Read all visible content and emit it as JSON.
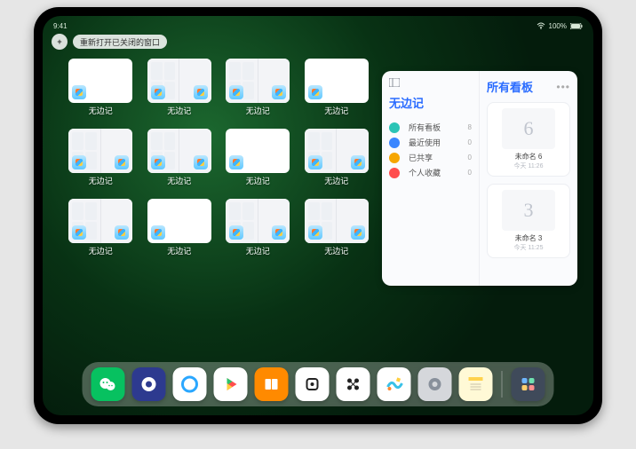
{
  "status": {
    "time": "9:41",
    "battery": "100%"
  },
  "topbar": {
    "add": "+",
    "reopen_label": "重新打开已关闭的窗口"
  },
  "appName": "无边记",
  "windows": [
    {
      "label": "无边记",
      "type": "blank"
    },
    {
      "label": "无边记",
      "type": "split"
    },
    {
      "label": "无边记",
      "type": "split"
    },
    {
      "label": "无边记",
      "type": "blank"
    },
    {
      "label": "无边记",
      "type": "split"
    },
    {
      "label": "无边记",
      "type": "split"
    },
    {
      "label": "无边记",
      "type": "blank"
    },
    {
      "label": "无边记",
      "type": "split"
    },
    {
      "label": "无边记",
      "type": "split"
    },
    {
      "label": "无边记",
      "type": "blank"
    },
    {
      "label": "无边记",
      "type": "split"
    },
    {
      "label": "无边记",
      "type": "split"
    }
  ],
  "panel": {
    "title": "无边记",
    "items": [
      {
        "icon": "circle",
        "color": "#2bc4b6",
        "label": "所有看板",
        "count": 8
      },
      {
        "icon": "clock",
        "color": "#3a86ff",
        "label": "最近使用",
        "count": 0
      },
      {
        "icon": "person",
        "color": "#f6a600",
        "label": "已共享",
        "count": 0
      },
      {
        "icon": "heart",
        "color": "#ff4d4d",
        "label": "个人收藏",
        "count": 0
      }
    ],
    "right": {
      "title": "所有看板",
      "boards": [
        {
          "glyph": "6",
          "name": "未命名 6",
          "sub": "今天 11:26"
        },
        {
          "glyph": "3",
          "name": "未命名 3",
          "sub": "今天 11:25"
        }
      ]
    }
  },
  "dock": [
    {
      "name": "wechat",
      "color": "#07c160",
      "glyph": "wechat"
    },
    {
      "name": "quark",
      "color": "#2d3a8f",
      "glyph": "quark"
    },
    {
      "name": "qqbrowser",
      "color": "#ffffff",
      "glyph": "qcircle"
    },
    {
      "name": "play",
      "color": "#ffffff",
      "glyph": "play"
    },
    {
      "name": "books",
      "color": "#ff8a00",
      "glyph": "books"
    },
    {
      "name": "goodnotes",
      "color": "#ffffff",
      "glyph": "gn"
    },
    {
      "name": "app-hex",
      "color": "#ffffff",
      "glyph": "hex"
    },
    {
      "name": "freeform",
      "color": "#ffffff",
      "glyph": "freeform"
    },
    {
      "name": "settings",
      "color": "#d5d7db",
      "glyph": "gear"
    },
    {
      "name": "notes",
      "color": "#fff9d6",
      "glyph": "notes"
    },
    {
      "name": "app-library",
      "color": "#3f4a5a",
      "glyph": "grid2"
    }
  ]
}
